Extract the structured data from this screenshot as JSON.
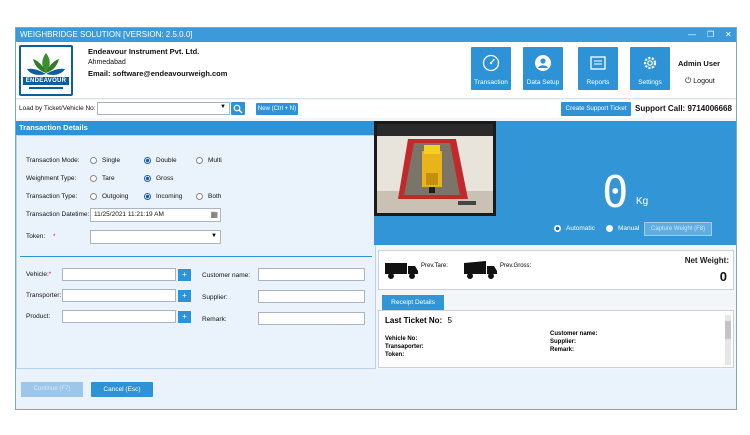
{
  "window": {
    "title": "WEIGHBRIDGE SOLUTION [VERSION: 2.5.0.0]",
    "controls": {
      "minimize": "—",
      "restore": "❐",
      "close": "✕"
    }
  },
  "header": {
    "logo_text": "ENDEAVOUR",
    "company_name": "Endeavour Instrument Pvt. Ltd.",
    "city": "Ahmedabad",
    "email": "Email: software@endeavourweigh.com",
    "nav": [
      {
        "label": "Transaction",
        "icon": "gauge-icon"
      },
      {
        "label": "Data Setup",
        "icon": "user-icon"
      },
      {
        "label": "Reports",
        "icon": "report-icon"
      },
      {
        "label": "Settings",
        "icon": "gear-icon"
      }
    ],
    "user": "Admin User",
    "logout": "Logout"
  },
  "toolbar": {
    "load_label": "Load by Ticket/Vehicle No:",
    "load_value": "",
    "new_button": "New (Ctrl + N)",
    "support_button": "Create Support Ticket",
    "support_call": "Support Call: 9714006668"
  },
  "transaction": {
    "title": "Transaction Details",
    "mode_label": "Transaction Mode:",
    "mode_options": [
      "Single",
      "Double",
      "Multi"
    ],
    "mode_selected": "Double",
    "weighment_label": "Weighment Type:",
    "weighment_options": [
      "Tare",
      "Gross"
    ],
    "weighment_selected": "Gross",
    "type_label": "Transaction Type:",
    "type_options": [
      "Outgoing",
      "Incoming",
      "Both"
    ],
    "type_selected": "Incoming",
    "datetime_label": "Transaction Datetime:",
    "datetime_value": "11/25/2021 11:21:19 AM",
    "token_label": "Token:",
    "token_required": "*",
    "token_value": ""
  },
  "fields": {
    "vehicle_label": "Vehicle:",
    "vehicle_required": "*",
    "transporter_label": "Transporter:",
    "product_label": "Product:",
    "customer_label": "Customer name:",
    "supplier_label": "Supplier:",
    "remark_label": "Remark:",
    "plus": "+"
  },
  "weight": {
    "value": "0",
    "unit": "Kg",
    "automatic": "Automatic",
    "manual": "Manual",
    "capture": "Capture Weight (F8)",
    "selected": "Automatic"
  },
  "prev": {
    "tare": "Prev.Tare:",
    "gross": "Prev.Gross:",
    "net_label": "Net Weight:",
    "net_value": "0"
  },
  "receipt": {
    "tab": "Receipt Details",
    "last_ticket_label": "Last Ticket No:",
    "last_ticket_value": "5",
    "vehicle": "Vehicle No:",
    "transporter": "Transaporter:",
    "token": "Token:",
    "customer": "Customer name:",
    "supplier": "Supplier:",
    "remark": "Remark:"
  },
  "bottom": {
    "continue": "Continue (F7)",
    "cancel": "Cancel (Esc)"
  },
  "colors": {
    "accent": "#2d93d6",
    "title_bar": "#3b9ad9",
    "panel_bg": "#eaf3fb"
  }
}
